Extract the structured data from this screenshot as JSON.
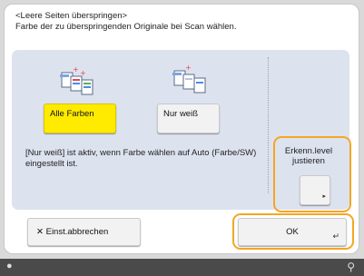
{
  "dialog": {
    "title_line1": "<Leere Seiten überspringen>",
    "title_line2": "Farbe der zu überspringenden Originale bei Scan wählen."
  },
  "options": {
    "all_colors_label": "Alle Farben",
    "white_only_label": "Nur weiß",
    "selected": "Alle Farben"
  },
  "info_text": "[Nur weiß] ist aktiv, wenn Farbe wählen auf Auto (Farbe/SW) eingestellt ist.",
  "detection_level": {
    "label_line1": "Erkenn.level",
    "label_line2": "justieren"
  },
  "footer": {
    "cancel_label": "Einst.abbrechen",
    "ok_label": "OK"
  },
  "icons": {
    "all_colors": "multicolor-documents-icon",
    "white_only": "white-documents-icon",
    "cancel": "close-icon",
    "ok_enter": "enter-icon",
    "level_arrow": "triangle-right-icon",
    "status_left": "status-dot-icon",
    "status_right": "network-icon"
  },
  "colors": {
    "selected_button": "#ffeb00",
    "highlight_border": "#f5a623",
    "panel_background": "#dde2ef"
  }
}
